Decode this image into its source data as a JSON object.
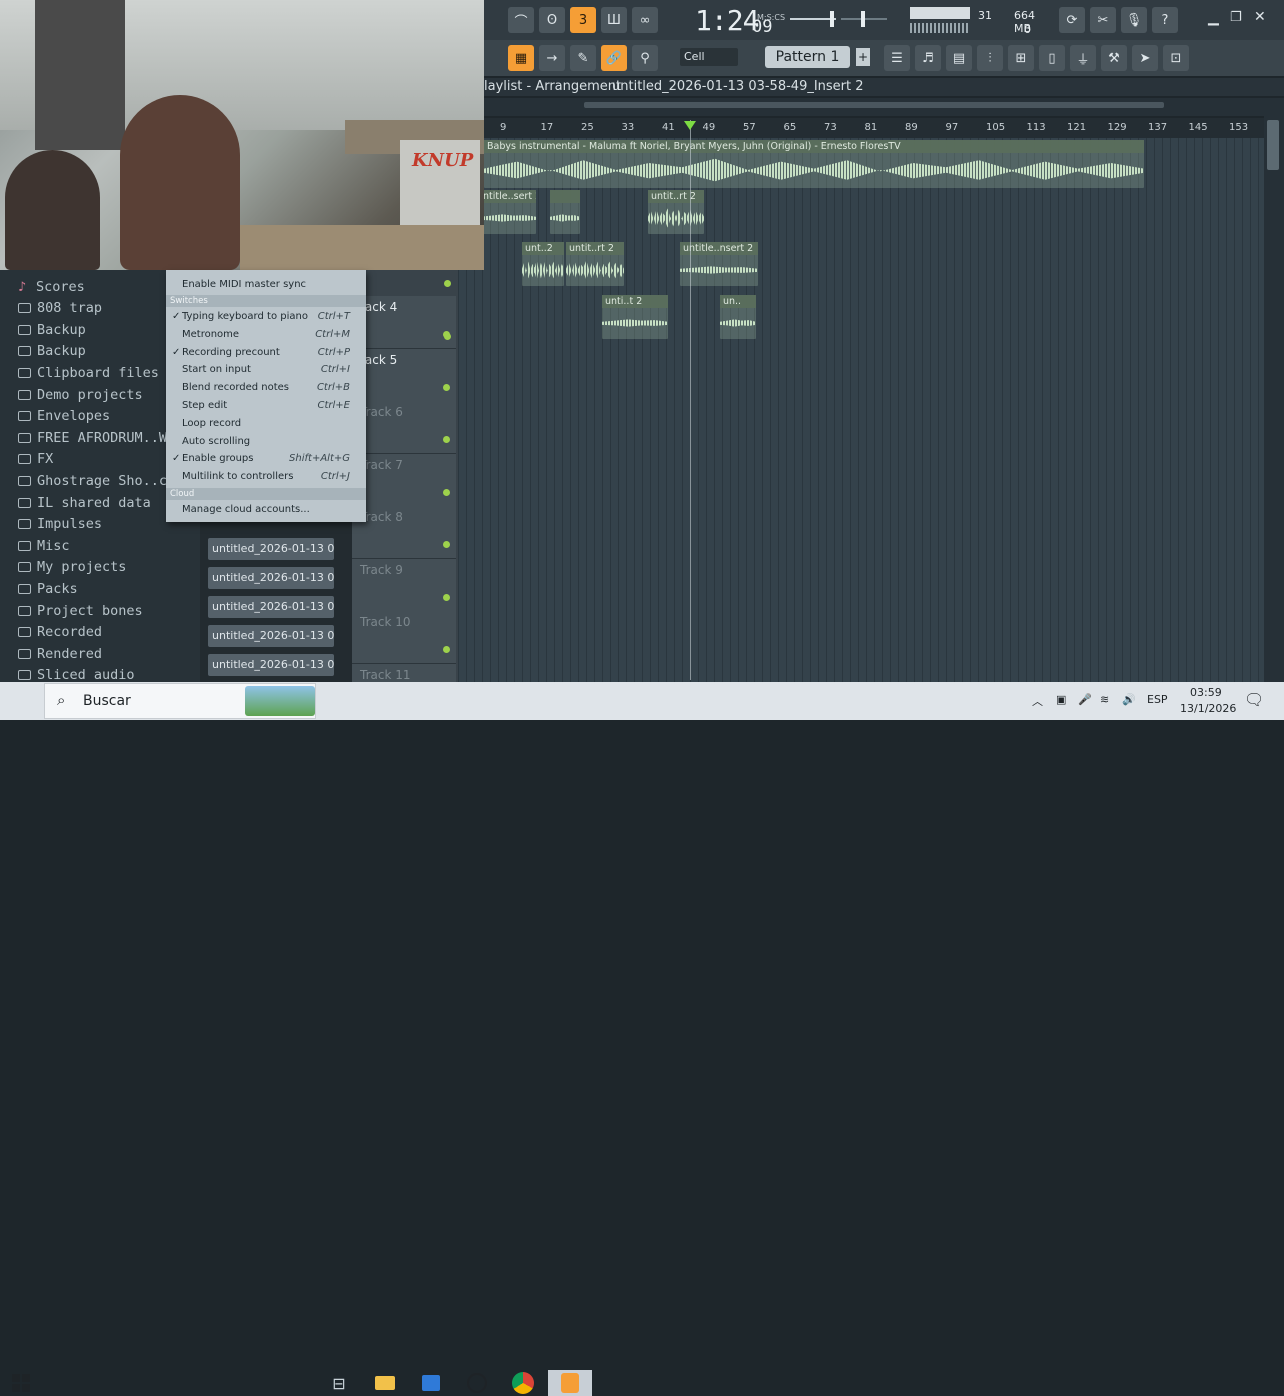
{
  "app": {
    "name": "FL Studio",
    "time_main": "1:24",
    "time_sec": "09",
    "time_unit": "M:S:CS",
    "cpu": "31",
    "memory": "664 MB",
    "polyphony": "0",
    "snap": "Cell",
    "pattern": "Pattern 1"
  },
  "playlist": {
    "title": "laylist - Arrangement",
    "path": "untitled_2026-01-13 03-58-49_Insert 2",
    "ruler": [
      "9",
      "17",
      "25",
      "33",
      "41",
      "49",
      "57",
      "65",
      "73",
      "81",
      "89",
      "97",
      "105",
      "113",
      "121",
      "129",
      "137",
      "145",
      "153"
    ],
    "clips": [
      {
        "label": "Babys instrumental - Maluma ft  Noriel, Bryant Myers, Juhn (Original) - Ernesto FloresTV"
      },
      {
        "label": "ntitle..sert 2"
      },
      {
        "label": ""
      },
      {
        "label": "untit..rt 2"
      },
      {
        "label": "unt..2"
      },
      {
        "label": "untit..rt 2"
      },
      {
        "label": "untitle..nsert 2"
      },
      {
        "label": "unti..t 2"
      },
      {
        "label": "un.."
      }
    ],
    "tracks": [
      "rack 4",
      "rack 5",
      "Track 6",
      "Track 7",
      "Track 8",
      "Track 9",
      "Track 10",
      "Track 11"
    ]
  },
  "browser": {
    "items": [
      "Scores",
      "808 trap",
      "Backup",
      "Backup",
      "Clipboard files",
      "Demo projects",
      "Envelopes",
      "FREE AFRODRUM..WITCH",
      "FX",
      "Ghostrage Sho..creen Dr",
      "IL shared data",
      "Impulses",
      "Misc",
      "My projects",
      "Packs",
      "Project bones",
      "Recorded",
      "Rendered",
      "Sliced audio"
    ]
  },
  "picker": {
    "items": [
      "untitled_2026-01-13 03-",
      "untitled_2026-01-13 03-",
      "untitled_2026-01-13 03-",
      "untitled_2026-01-13 03-",
      "untitled_2026-01-13 03-",
      "untitled_2026-01-13 03-"
    ]
  },
  "menu": {
    "top_item": "Enable MIDI master sync",
    "section_switches": "Switches",
    "items": [
      {
        "label": "Typing keyboard to piano",
        "shortcut": "Ctrl+T",
        "checked": "✓"
      },
      {
        "label": "Metronome",
        "shortcut": "Ctrl+M",
        "checked": ""
      },
      {
        "label": "Recording precount",
        "shortcut": "Ctrl+P",
        "checked": "✓"
      },
      {
        "label": "Start on input",
        "shortcut": "Ctrl+I",
        "checked": ""
      },
      {
        "label": "Blend recorded notes",
        "shortcut": "Ctrl+B",
        "checked": ""
      },
      {
        "label": "Step edit",
        "shortcut": "Ctrl+E",
        "checked": ""
      },
      {
        "label": "Loop record",
        "shortcut": "",
        "checked": ""
      },
      {
        "label": "Auto scrolling",
        "shortcut": "",
        "checked": ""
      },
      {
        "label": "Enable groups",
        "shortcut": "Shift+Alt+G",
        "checked": "✓"
      },
      {
        "label": "Multilink to controllers",
        "shortcut": "Ctrl+J",
        "checked": ""
      }
    ],
    "section_cloud": "Cloud",
    "cloud_item": "Manage cloud accounts..."
  },
  "webcam": {
    "box_text": "KNUP"
  },
  "taskbar": {
    "search_placeholder": "Buscar",
    "lang": "ESP",
    "time": "03:59",
    "date": "13/1/2026"
  },
  "colors": {
    "accent": "#f59e36",
    "track_dot": "#9ed24c",
    "wave": "#c7e0c4"
  }
}
